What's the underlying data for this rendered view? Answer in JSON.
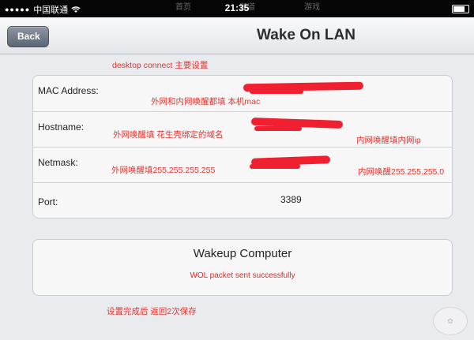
{
  "statusbar": {
    "signal_dots": "●●●●●",
    "carrier": "中国联通",
    "time": "21:35",
    "right_text": "",
    "ghost_tab1": "首页",
    "ghost_tab2": "频道",
    "ghost_tab3": "游戏"
  },
  "navbar": {
    "back_label": "Back",
    "title": "Wake On LAN"
  },
  "settings": {
    "mac_label": "MAC Address:",
    "hostname_label": "Hostname:",
    "netmask_label": "Netmask:",
    "port_label": "Port:",
    "port_value": "3389"
  },
  "wake": {
    "button_label": "Wakeup Computer",
    "status": "WOL packet sent successfully"
  },
  "annotations": {
    "header": "desktop connect 主要设置",
    "mac": "外网和内网唤醒都填  本机mac",
    "hostname_wan": "外网唤醒填 花生壳绑定的域名",
    "hostname_lan": "内网唤醒填内网ip",
    "netmask_wan": "外网唤醒填255.255.255.255",
    "netmask_lan": "内网唤醒255.255.255.0",
    "footer": "设置完成后 返回2次保存"
  },
  "colors": {
    "annotation_red": "#e8322d",
    "back_button": "#6b7482"
  }
}
